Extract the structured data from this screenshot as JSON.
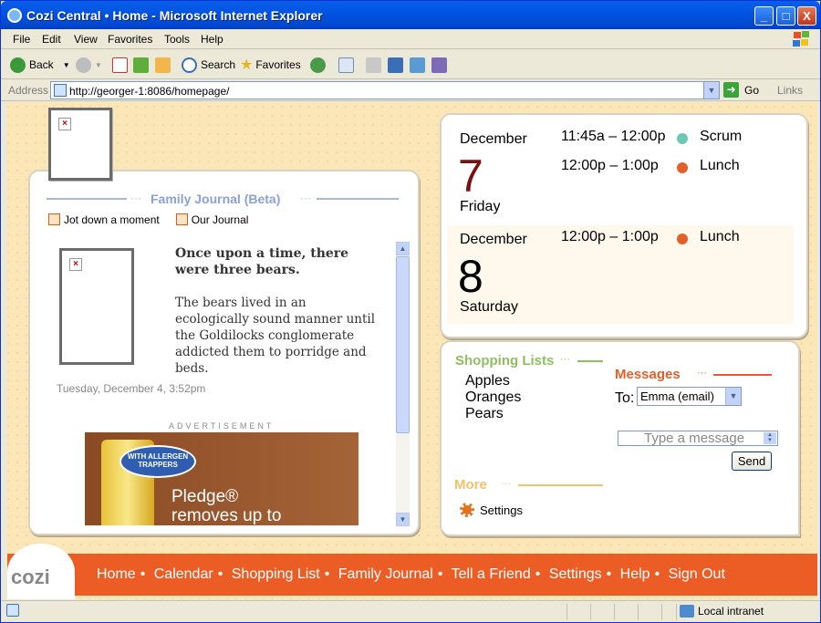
{
  "window": {
    "title": "Cozi Central • Home - Microsoft Internet Explorer",
    "minimize": "_",
    "maximize": "□",
    "close": "X"
  },
  "menu": [
    "File",
    "Edit",
    "View",
    "Favorites",
    "Tools",
    "Help"
  ],
  "toolbar": {
    "back": "Back",
    "search": "Search",
    "favorites": "Favorites"
  },
  "address": {
    "label": "Address",
    "url": "http://georger-1:8086/homepage/",
    "go": "Go",
    "links": "Links"
  },
  "journal": {
    "heading": "Family Journal (Beta)",
    "jot": "Jot down a moment",
    "our": "Our Journal",
    "entry_title": "Once upon a time, there were three bears.",
    "entry_body": "The bears lived in an ecologically sound manner until the Goldilocks conglomerate addicted them to porridge and beds.",
    "entry_date": "Tuesday, December 4, 3:52pm",
    "ad_label": "ADVERTISEMENT",
    "ad_badge": "WITH ALLERGEN TRAPPERS",
    "ad_line1": "Pledge®",
    "ad_line2": "removes up to"
  },
  "calendar": {
    "days": [
      {
        "month": "December",
        "day": "7",
        "weekday": "Friday",
        "day_color": "#7a1010",
        "events": [
          {
            "time": "11:45a – 12:00p",
            "name": "Scrum",
            "color": "#6cc7b5"
          },
          {
            "time": "12:00p – 1:00p",
            "name": "Lunch",
            "color": "#e4602a"
          }
        ]
      },
      {
        "month": "December",
        "day": "8",
        "weekday": "Saturday",
        "day_color": "#000000",
        "events": [
          {
            "time": "12:00p – 1:00p",
            "name": "Lunch",
            "color": "#e4602a"
          }
        ]
      }
    ]
  },
  "shopping": {
    "heading": "Shopping Lists",
    "heading_color": "#8fbf5f",
    "items": [
      "Apples",
      "Oranges",
      "Pears"
    ]
  },
  "messages": {
    "heading": "Messages",
    "heading_color": "#e4602a",
    "to_label": "To:",
    "to_value": "Emma (email)",
    "placeholder": "Type a message",
    "send": "Send"
  },
  "more": {
    "heading": "More",
    "heading_color": "#f1c36a",
    "settings": "Settings"
  },
  "nav": [
    "Home",
    "Calendar",
    "Shopping List",
    "Family Journal",
    "Tell a Friend",
    "Settings",
    "Help",
    "Sign Out"
  ],
  "logo": "cozi",
  "status": {
    "zone": "Local intranet"
  }
}
